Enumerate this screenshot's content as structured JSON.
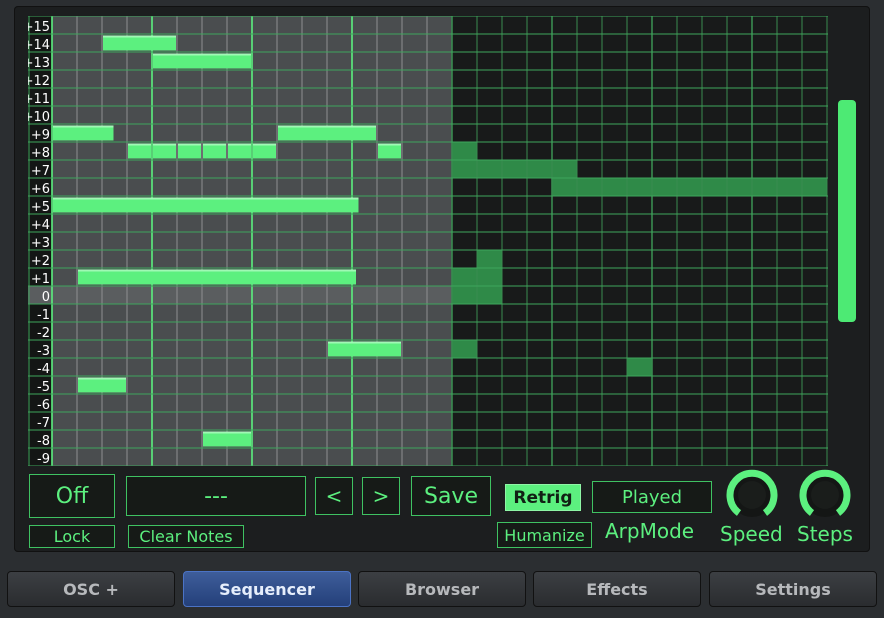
{
  "colors": {
    "accent": "#5cf07f",
    "note_dim": "#2f8a48",
    "grid_line": "#3ea55c",
    "active_tab": "#3553a0"
  },
  "grid": {
    "row_labels": [
      "+15",
      "+14",
      "+13",
      "+12",
      "+11",
      "+10",
      "+9",
      "+8",
      "+7",
      "+6",
      "+5",
      "+4",
      "+3",
      "+2",
      "+1",
      "0",
      "-1",
      "-2",
      "-3",
      "-4",
      "-5",
      "-6",
      "-7",
      "-8",
      "-9"
    ],
    "steps": 32,
    "loop_length": 16,
    "notes": [
      {
        "row": "+14",
        "start": 2,
        "length": 3
      },
      {
        "row": "+13",
        "start": 4,
        "length": 4
      },
      {
        "row": "+9",
        "start": 0,
        "length": 2.5
      },
      {
        "row": "+9",
        "start": 9,
        "length": 4
      },
      {
        "row": "+8",
        "start": 3,
        "length": 1
      },
      {
        "row": "+8",
        "start": 4,
        "length": 1
      },
      {
        "row": "+8",
        "start": 5,
        "length": 1
      },
      {
        "row": "+8",
        "start": 6,
        "length": 1
      },
      {
        "row": "+8",
        "start": 7,
        "length": 1
      },
      {
        "row": "+8",
        "start": 8,
        "length": 1
      },
      {
        "row": "+8",
        "start": 13,
        "length": 1
      },
      {
        "row": "+5",
        "start": 0,
        "length": 12.3
      },
      {
        "row": "+1",
        "start": 1,
        "length": 11.2
      },
      {
        "row": "-3",
        "start": 11,
        "length": 3
      },
      {
        "row": "-5",
        "start": 1,
        "length": 2
      },
      {
        "row": "-8",
        "start": 6,
        "length": 2
      }
    ],
    "ghost_notes": [
      {
        "row": "+8",
        "start": 16,
        "length": 1
      },
      {
        "row": "+7",
        "start": 16,
        "length": 5
      },
      {
        "row": "+6",
        "start": 20,
        "length": 11
      },
      {
        "row": "+2",
        "start": 17,
        "length": 1
      },
      {
        "row": "+1",
        "start": 16,
        "length": 2
      },
      {
        "row": "0",
        "start": 16,
        "length": 2
      },
      {
        "row": "-3",
        "start": 16,
        "length": 1
      },
      {
        "row": "-4",
        "start": 23,
        "length": 1
      }
    ]
  },
  "controls": {
    "off_label": "Off",
    "lock_label": "Lock",
    "preset_name": "---",
    "clear_notes_label": "Clear Notes",
    "prev_label": "<",
    "next_label": ">",
    "save_label": "Save",
    "retrig_label": "Retrig",
    "humanize_label": "Humanize",
    "arpmode_value": "Played",
    "arpmode_label": "ArpMode",
    "speed_label": "Speed",
    "steps_label": "Steps",
    "speed_knob_icon": "knob-icon",
    "steps_knob_icon": "knob-icon"
  },
  "tabs": [
    {
      "label": "OSC +",
      "active": false
    },
    {
      "label": "Sequencer",
      "active": true
    },
    {
      "label": "Browser",
      "active": false
    },
    {
      "label": "Effects",
      "active": false
    },
    {
      "label": "Settings",
      "active": false
    }
  ]
}
